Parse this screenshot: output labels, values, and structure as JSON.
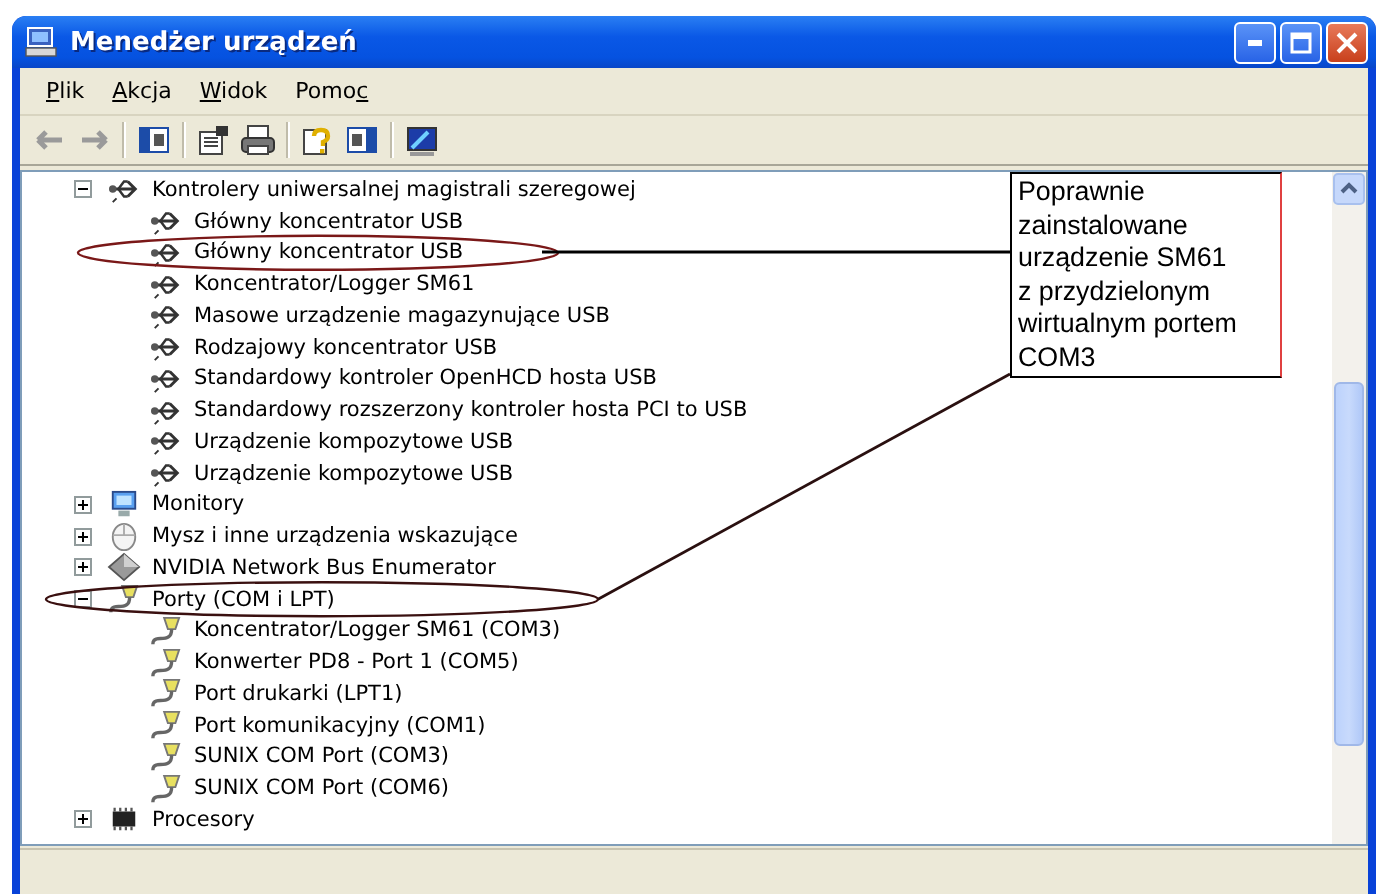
{
  "window": {
    "title": "Menedżer urządzeń"
  },
  "menu": [
    {
      "key": "P",
      "post": "lik"
    },
    {
      "key": "A",
      "post": "kcja"
    },
    {
      "key": "W",
      "post": "idok"
    },
    {
      "pre": "Pomo",
      "key": "c"
    }
  ],
  "toolbar": [
    {
      "kind": "back",
      "disabled": true
    },
    {
      "kind": "forward",
      "disabled": true
    },
    {
      "kind": "sep"
    },
    {
      "kind": "panel"
    },
    {
      "kind": "sep"
    },
    {
      "kind": "properties"
    },
    {
      "kind": "print"
    },
    {
      "kind": "sep"
    },
    {
      "kind": "help"
    },
    {
      "kind": "panel2"
    },
    {
      "kind": "sep"
    },
    {
      "kind": "scan"
    }
  ],
  "tree": [
    {
      "label": "Kontrolery uniwersalnej magistrali szeregowej",
      "kind": "usb",
      "expanded": true,
      "children": [
        {
          "label": "Główny koncentrator USB",
          "kind": "usb"
        },
        {
          "label": "Główny koncentrator USB",
          "kind": "usb"
        },
        {
          "label": "Koncentrator/Logger SM61",
          "kind": "usb"
        },
        {
          "label": "Masowe urządzenie magazynujące USB",
          "kind": "usb"
        },
        {
          "label": "Rodzajowy koncentrator USB",
          "kind": "usb"
        },
        {
          "label": "Standardowy kontroler OpenHCD hosta USB",
          "kind": "usb"
        },
        {
          "label": "Standardowy rozszerzony kontroler hosta PCI to USB",
          "kind": "usb"
        },
        {
          "label": "Urządzenie kompozytowe USB",
          "kind": "usb"
        },
        {
          "label": "Urządzenie kompozytowe USB",
          "kind": "usb"
        }
      ]
    },
    {
      "label": "Monitory",
      "kind": "monitor",
      "expanded": false
    },
    {
      "label": "Mysz i inne urządzenia wskazujące",
      "kind": "mouse",
      "expanded": false
    },
    {
      "label": "NVIDIA Network Bus Enumerator",
      "kind": "network",
      "expanded": false
    },
    {
      "label": "Porty (COM i LPT)",
      "kind": "port",
      "expanded": true,
      "children": [
        {
          "label": "Koncentrator/Logger SM61 (COM3)",
          "kind": "port"
        },
        {
          "label": "Konwerter PD8 - Port 1 (COM5)",
          "kind": "port"
        },
        {
          "label": "Port drukarki (LPT1)",
          "kind": "port"
        },
        {
          "label": "Port komunikacyjny (COM1)",
          "kind": "port"
        },
        {
          "label": "SUNIX COM Port (COM3)",
          "kind": "port"
        },
        {
          "label": "SUNIX COM Port (COM6)",
          "kind": "port"
        }
      ]
    },
    {
      "label": "Procesory",
      "kind": "chip",
      "expanded": false
    }
  ],
  "annotation": {
    "text": "Poprawnie zainstalowane urządzenie SM61 z przydzielonym wirtualnym portem COM3"
  }
}
